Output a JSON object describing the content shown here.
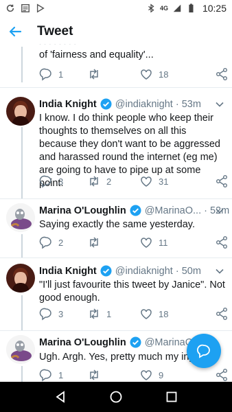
{
  "status_bar": {
    "time": "10:25",
    "network": "4G"
  },
  "app_bar": {
    "title": "Tweet"
  },
  "colors": {
    "accent": "#1da1f2",
    "gray": "#657786",
    "verified": "#1da1f2"
  },
  "previous_tweet": {
    "text_line": "of 'fairness and equality'...",
    "replies": "1",
    "retweets": "",
    "likes": "18"
  },
  "tweets": [
    {
      "name": "India Knight",
      "handle": "@indiaknight · 53m",
      "text": "I know. I do think people who keep their thoughts to themselves on all this because they don't want to be aggressed and harassed round the internet (eg me) are going to have to pipe up at some point.",
      "replies": "3",
      "retweets": "2",
      "likes": "31"
    },
    {
      "name": "Marina O'Loughlin",
      "handle": "@MarinaO... · 52m",
      "text": "Saying exactly the same yesterday.",
      "replies": "2",
      "retweets": "",
      "likes": "11"
    },
    {
      "name": "India Knight",
      "handle": "@indiaknight · 50m",
      "text": "\"I'll just favourite this tweet by Janice\". Not good enough.",
      "replies": "3",
      "retweets": "1",
      "likes": "18"
    },
    {
      "name": "Marina O'Loughlin",
      "handle": "@MarinaO...",
      "text": "Ugh. Argh. Yes, pretty much my input",
      "replies": "1",
      "retweets": "",
      "likes": "9"
    }
  ]
}
